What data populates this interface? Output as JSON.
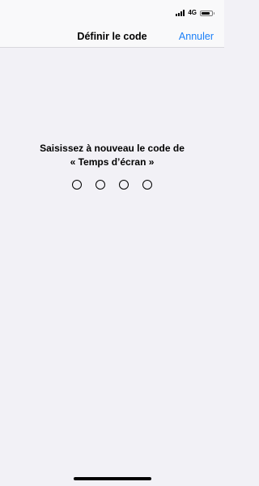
{
  "status_bar": {
    "network": "4G",
    "signal_bars": 4,
    "battery_level": 0.8,
    "signal_icon": "cellular-signal-icon",
    "battery_icon": "battery-icon"
  },
  "nav": {
    "title": "Définir le code",
    "cancel_label": "Annuler",
    "accent_color": "#1a7ff8"
  },
  "prompt": {
    "line1": "Saisissez à nouveau le code de",
    "line2": "« Temps d’écran »"
  },
  "passcode": {
    "length": 4,
    "entered": 0
  }
}
